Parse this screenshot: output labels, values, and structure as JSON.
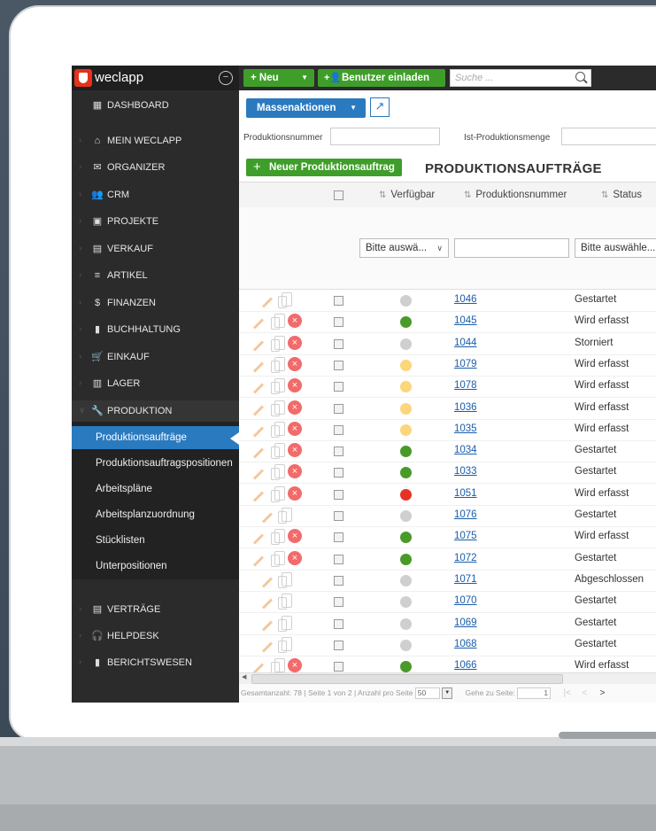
{
  "app": {
    "logo_text": "weclapp",
    "collapse_icon": "minus-circle-icon"
  },
  "sidebar": {
    "items": [
      {
        "label": "DASHBOARD",
        "icon": "dashboard-icon",
        "glyph": "▦"
      },
      {
        "label": "MEIN WECLAPP",
        "icon": "home-icon",
        "glyph": "⌂"
      },
      {
        "label": "ORGANIZER",
        "icon": "mail-icon",
        "glyph": "✉"
      },
      {
        "label": "CRM",
        "icon": "users-icon",
        "glyph": "👥"
      },
      {
        "label": "PROJEKTE",
        "icon": "briefcase-icon",
        "glyph": "▣"
      },
      {
        "label": "VERKAUF",
        "icon": "document-icon",
        "glyph": "▤"
      },
      {
        "label": "ARTIKEL",
        "icon": "list-icon",
        "glyph": "≡"
      },
      {
        "label": "FINANZEN",
        "icon": "dollar-icon",
        "glyph": "$"
      },
      {
        "label": "BUCHHALTUNG",
        "icon": "book-icon",
        "glyph": "▮"
      },
      {
        "label": "EINKAUF",
        "icon": "cart-icon",
        "glyph": "🛒"
      },
      {
        "label": "LAGER",
        "icon": "warehouse-icon",
        "glyph": "▥"
      },
      {
        "label": "PRODUKTION",
        "icon": "wrench-icon",
        "glyph": "🔧"
      }
    ],
    "sub_items": [
      "Produktionsaufträge",
      "Produktionsauftragspositionen",
      "Arbeitspläne",
      "Arbeitsplanzuordnung",
      "Stücklisten",
      "Unterpositionen"
    ],
    "bottom_items": [
      {
        "label": "VERTRÄGE",
        "icon": "contract-icon",
        "glyph": "▤"
      },
      {
        "label": "HELPDESK",
        "icon": "headset-icon",
        "glyph": "🎧"
      },
      {
        "label": "BERICHTSWESEN",
        "icon": "bar-chart-icon",
        "glyph": "▮"
      }
    ]
  },
  "topbar": {
    "new_label": "+ Neu",
    "invite_label": "Benutzer einladen",
    "search_placeholder": "Suche ..."
  },
  "toolbar": {
    "mass_actions": "Massenaktionen"
  },
  "filters": {
    "produktionsnummer": "Produktionsnummer",
    "ist_menge": "Ist-Produktionsmenge"
  },
  "page": {
    "new_order": "Neuer Produktionsauftrag",
    "title": "PRODUKTIONSAUFTRÄGE"
  },
  "columns": {
    "verfuegbar": "Verfügbar",
    "produktionsnummer": "Produktionsnummer",
    "status": "Status"
  },
  "column_filters": {
    "verfuegbar_select": "Bitte auswä...",
    "status_select": "Bitte auswähle..."
  },
  "colors": {
    "gray": "#cfcfcf",
    "green": "#4a9a2a",
    "yellow": "#fdd57a",
    "red": "#e53224"
  },
  "rows": [
    {
      "nr": "1046",
      "status": "Gestartet",
      "avail": "gray",
      "del": false
    },
    {
      "nr": "1045",
      "status": "Wird erfasst",
      "avail": "green",
      "del": true
    },
    {
      "nr": "1044",
      "status": "Storniert",
      "avail": "gray",
      "del": true
    },
    {
      "nr": "1079",
      "status": "Wird erfasst",
      "avail": "yellow",
      "del": true
    },
    {
      "nr": "1078",
      "status": "Wird erfasst",
      "avail": "yellow",
      "del": true
    },
    {
      "nr": "1036",
      "status": "Wird erfasst",
      "avail": "yellow",
      "del": true
    },
    {
      "nr": "1035",
      "status": "Wird erfasst",
      "avail": "yellow",
      "del": true
    },
    {
      "nr": "1034",
      "status": "Gestartet",
      "avail": "green",
      "del": true
    },
    {
      "nr": "1033",
      "status": "Gestartet",
      "avail": "green",
      "del": true
    },
    {
      "nr": "1051",
      "status": "Wird erfasst",
      "avail": "red",
      "del": true
    },
    {
      "nr": "1076",
      "status": "Gestartet",
      "avail": "gray",
      "del": false
    },
    {
      "nr": "1075",
      "status": "Wird erfasst",
      "avail": "green",
      "del": true
    },
    {
      "nr": "1072",
      "status": "Gestartet",
      "avail": "green",
      "del": true
    },
    {
      "nr": "1071",
      "status": "Abgeschlossen",
      "avail": "gray",
      "del": false
    },
    {
      "nr": "1070",
      "status": "Gestartet",
      "avail": "gray",
      "del": false
    },
    {
      "nr": "1069",
      "status": "Gestartet",
      "avail": "gray",
      "del": false
    },
    {
      "nr": "1068",
      "status": "Gestartet",
      "avail": "gray",
      "del": false
    },
    {
      "nr": "1066",
      "status": "Wird erfasst",
      "avail": "green",
      "del": true
    }
  ],
  "footer": {
    "total": "Gesamtanzahl: 78",
    "page": "Seite 1 von 2",
    "per_page_label": "Anzahl pro Seite",
    "per_page_value": "50",
    "goto": "Gehe zu Seite:",
    "goto_value": "1"
  }
}
